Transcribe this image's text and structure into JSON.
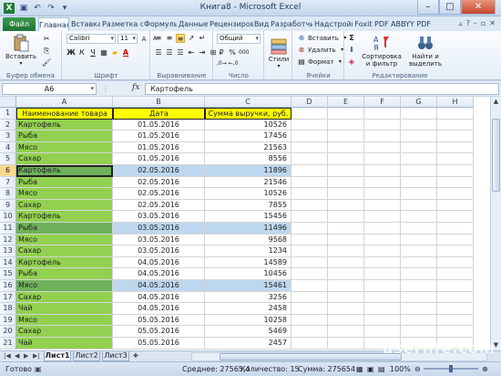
{
  "window": {
    "title": "Книга8 - Microsoft Excel",
    "app_icon": "X"
  },
  "ribbon_tabs": [
    {
      "label": "Файл"
    },
    {
      "label": "Главная"
    },
    {
      "label": "Вставка"
    },
    {
      "label": "Разметка ст"
    },
    {
      "label": "Формулы"
    },
    {
      "label": "Данные"
    },
    {
      "label": "Рецензирование"
    },
    {
      "label": "Вид"
    },
    {
      "label": "Разработчик"
    },
    {
      "label": "Надстройки"
    },
    {
      "label": "Foxit PDF"
    },
    {
      "label": "ABBYY PDF T"
    }
  ],
  "ribbon": {
    "clipboard": {
      "paste": "Вставить",
      "group": "Буфер обмена"
    },
    "font": {
      "name": "Calibri",
      "size": "11",
      "group": "Шрифт",
      "bold": "Ж",
      "italic": "К",
      "underline": "Ч"
    },
    "alignment": {
      "group": "Выравнивание"
    },
    "number": {
      "format": "Общий",
      "group": "Число",
      "percent": "%",
      "thousands": "000"
    },
    "styles": {
      "label": "Стили"
    },
    "cells": {
      "insert": "Вставить",
      "delete": "Удалить",
      "format": "Формат",
      "group": "Ячейки"
    },
    "editing": {
      "sort": "Сортировка и фильтр",
      "find": "Найти и выделить",
      "group": "Редактирование",
      "sum": "Σ"
    }
  },
  "formula_bar": {
    "name_box": "A6",
    "fx": "fx",
    "content": "Картофель"
  },
  "columns": [
    "A",
    "B",
    "C",
    "D",
    "E",
    "F",
    "G",
    "H"
  ],
  "table": {
    "headers": [
      "Наименование товара",
      "Дата",
      "Сумма выручки, руб."
    ],
    "rows": [
      {
        "num": "2",
        "name": "Картофель",
        "date": "01.05.2016",
        "sum": "10526",
        "hl": false
      },
      {
        "num": "3",
        "name": "Рыба",
        "date": "01.05.2016",
        "sum": "17456",
        "hl": false
      },
      {
        "num": "4",
        "name": "Мясо",
        "date": "01.05.2016",
        "sum": "21563",
        "hl": false
      },
      {
        "num": "5",
        "name": "Сахар",
        "date": "01.05.2016",
        "sum": "8556",
        "hl": false
      },
      {
        "num": "6",
        "name": "Картофель",
        "date": "02.05.2016",
        "sum": "11896",
        "hl": true
      },
      {
        "num": "7",
        "name": "Рыба",
        "date": "02.05.2016",
        "sum": "21546",
        "hl": false
      },
      {
        "num": "8",
        "name": "Мясо",
        "date": "02.05.2016",
        "sum": "10526",
        "hl": false
      },
      {
        "num": "9",
        "name": "Сахар",
        "date": "02.05.2016",
        "sum": "7855",
        "hl": false
      },
      {
        "num": "10",
        "name": "Картофель",
        "date": "03.05.2016",
        "sum": "15456",
        "hl": false
      },
      {
        "num": "11",
        "name": "Рыба",
        "date": "03.05.2016",
        "sum": "11496",
        "hl": true
      },
      {
        "num": "12",
        "name": "Мясо",
        "date": "03.05.2016",
        "sum": "9568",
        "hl": false
      },
      {
        "num": "13",
        "name": "Сахар",
        "date": "03.05.2016",
        "sum": "1234",
        "hl": false
      },
      {
        "num": "14",
        "name": "Картофель",
        "date": "04.05.2016",
        "sum": "14589",
        "hl": false
      },
      {
        "num": "15",
        "name": "Рыба",
        "date": "04.05.2016",
        "sum": "10456",
        "hl": false
      },
      {
        "num": "16",
        "name": "Мясо",
        "date": "04.05.2016",
        "sum": "15461",
        "hl": true
      },
      {
        "num": "17",
        "name": "Сахар",
        "date": "04.05.2016",
        "sum": "3256",
        "hl": false
      },
      {
        "num": "18",
        "name": "Чай",
        "date": "04.05.2016",
        "sum": "2458",
        "hl": false
      },
      {
        "num": "19",
        "name": "Мясо",
        "date": "05.05.2016",
        "sum": "10258",
        "hl": false
      },
      {
        "num": "20",
        "name": "Сахар",
        "date": "05.05.2016",
        "sum": "5469",
        "hl": false
      },
      {
        "num": "21",
        "name": "Чай",
        "date": "05.05.2016",
        "sum": "2457",
        "hl": false
      }
    ]
  },
  "header_row_num": "1",
  "sheets": [
    "Лист1",
    "Лист2",
    "Лист3"
  ],
  "status": {
    "ready": "Готово",
    "average": "Среднее: 27565,4",
    "count": "Количество: 15",
    "sum": "Сумма: 275654",
    "zoom": "100%"
  },
  "watermark": "userlife.com",
  "colors": {
    "header_fill": "#ffff00",
    "name_fill": "#92d050",
    "highlight_fill": "#bdd7ee",
    "file_tab": "#1f7434"
  }
}
